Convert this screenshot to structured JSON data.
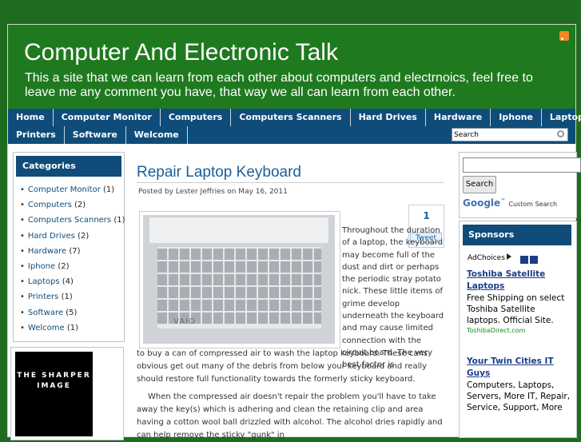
{
  "header": {
    "title": "Computer And Electronic Talk",
    "description": "This a site that we can learn from each other about computers and electrnoics, feel free to leave me any comment you have, that way we all can learn from each other."
  },
  "nav": {
    "row1": [
      "Home",
      "Computer Monitor",
      "Computers",
      "Computers Scanners",
      "Hard Drives",
      "Hardware",
      "Iphone",
      "Laptops"
    ],
    "row2": [
      "Printers",
      "Software",
      "Welcome"
    ],
    "search_value": "Search"
  },
  "sidebar": {
    "title": "Categories",
    "items": [
      {
        "label": "Computer Monitor",
        "count": "(1)"
      },
      {
        "label": "Computers",
        "count": "(2)"
      },
      {
        "label": "Computers Scanners",
        "count": "(1)"
      },
      {
        "label": "Hard Drives",
        "count": "(2)"
      },
      {
        "label": "Hardware",
        "count": "(7)"
      },
      {
        "label": "Iphone",
        "count": "(2)"
      },
      {
        "label": "Laptops",
        "count": "(4)"
      },
      {
        "label": "Printers",
        "count": "(1)"
      },
      {
        "label": "Software",
        "count": "(5)"
      },
      {
        "label": "Welcome",
        "count": "(1)"
      }
    ],
    "ad_text": "THE SHARPER IMAGE"
  },
  "post": {
    "title": "Repair Laptop Keyboard",
    "meta": "Posted by Lester Jeffries on May 16, 2011",
    "image_brand": "VAIO",
    "tweet_count": "1",
    "tweet_label": "Tweet",
    "para1_wrap": "Throughout the duration of a laptop, the keyboard may become full of the dust and dirt or perhaps the periodic stray potato nick. These little items of grime develop underneath the keyboard and may cause limited connection with the circuit board. The very best factor is",
    "para1_rest": "to buy a can of compressed air to wash the laptop keyboard. These cans obvious get out many of the debris from below your keyboard and really should restore full functionality towards the formerly sticky keyboard.",
    "para2": "When the compressed air doesn't repair the problem you'll have to take away the key(s) which is adhering and clean the retaining clip and area having a cotton wool ball drizzled with alcohol. The alcohol dries rapidly and can help remove the sticky \"gunk\" in"
  },
  "right": {
    "search_button": "Search",
    "google_label": "Google",
    "custom_search": "Custom Search",
    "sponsors_title": "Sponsors",
    "adchoices": "AdChoices",
    "ads": [
      {
        "head": "Toshiba Satellite Laptops",
        "body": "Free Shipping on select Toshiba Satellite laptops. Official Site.",
        "url": "ToshibaDirect.com"
      },
      {
        "head": "Your Twin Cities IT Guys",
        "body": "Computers, Laptops, Servers, More IT, Repair, Service, Support, More",
        "url": ""
      }
    ]
  }
}
